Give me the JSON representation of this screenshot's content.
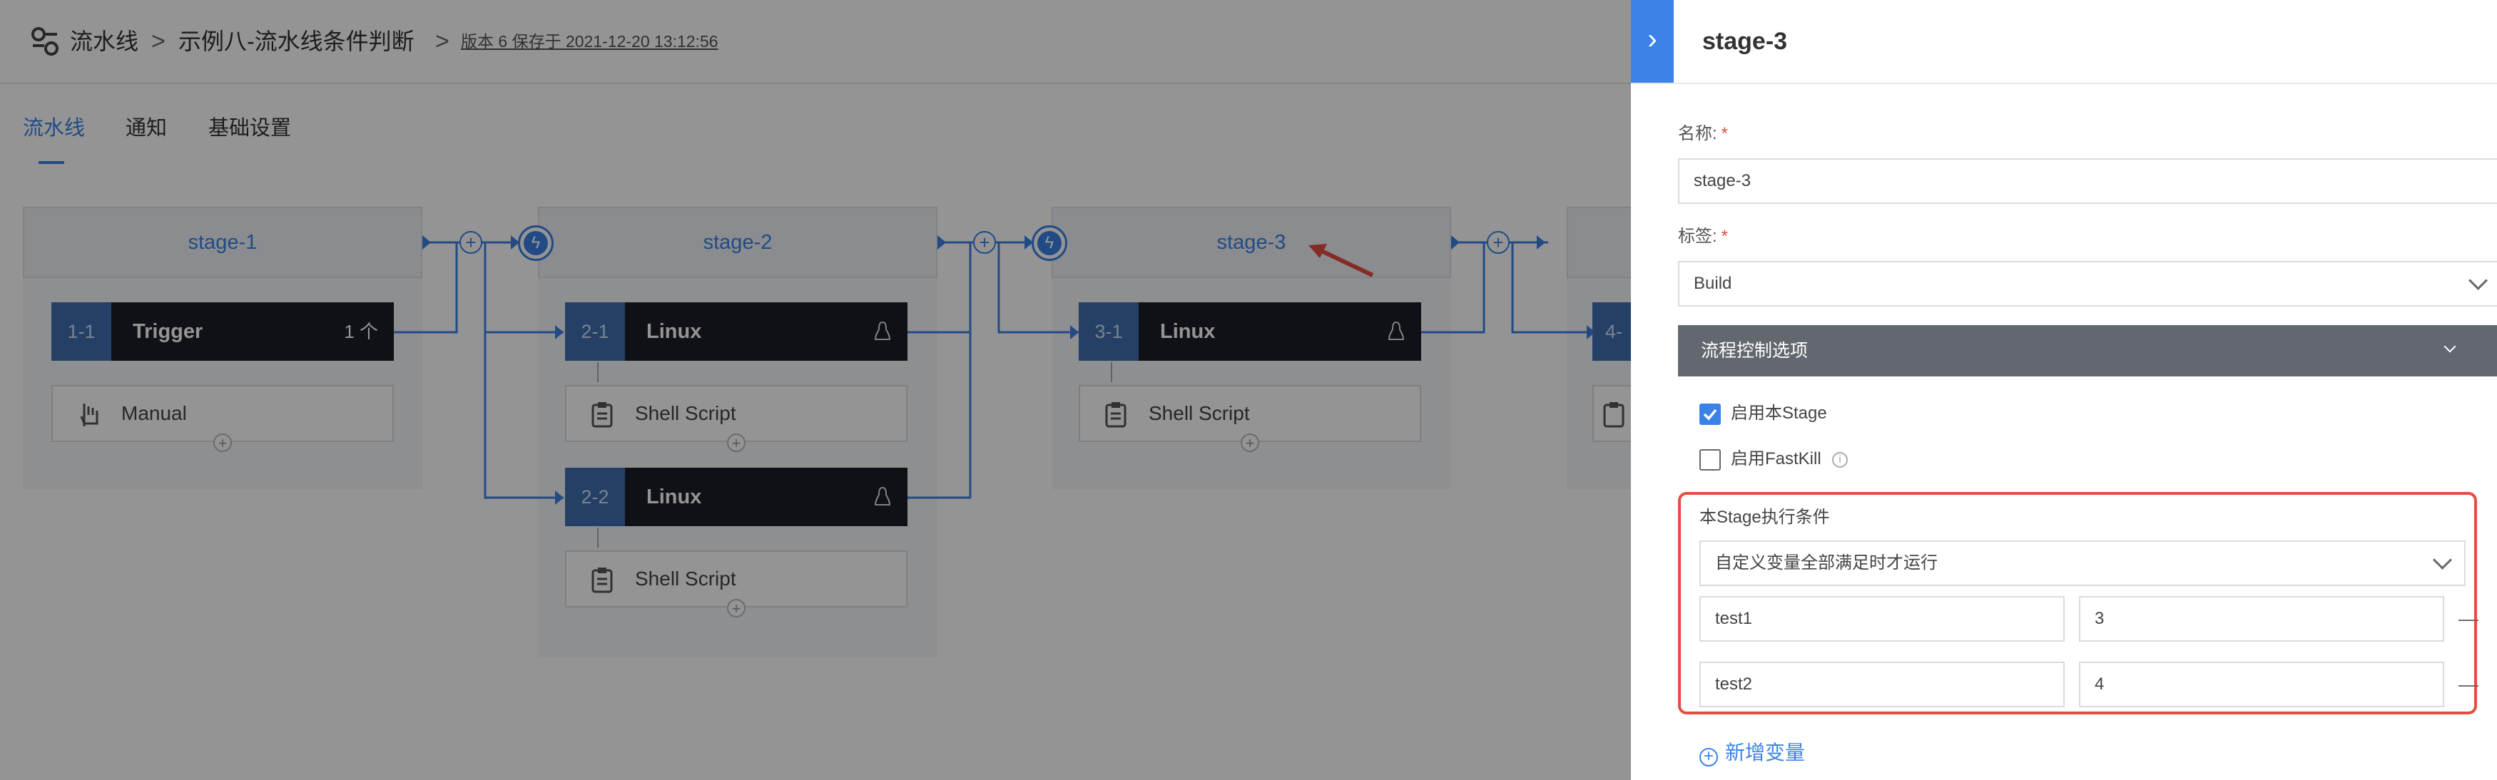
{
  "breadcrumb": {
    "root": "流水线",
    "separator": ">",
    "pipeline_name": "示例八-流水线条件判断",
    "version_info": "版本 6 保存于 2021-12-20 13:12:56"
  },
  "tabs": [
    {
      "label": "流水线",
      "active": true
    },
    {
      "label": "通知",
      "active": false
    },
    {
      "label": "基础设置",
      "active": false
    }
  ],
  "pipeline": {
    "stages": [
      {
        "name": "stage-1",
        "jobs": [
          {
            "num": "1-1",
            "title": "Trigger",
            "badge": "1 个",
            "atom": "Manual",
            "atom_icon": "hand-icon"
          }
        ]
      },
      {
        "name": "stage-2",
        "jobs": [
          {
            "num": "2-1",
            "title": "Linux",
            "os_icon": "linux-icon",
            "atom": "Shell Script",
            "atom_icon": "clipboard-icon"
          },
          {
            "num": "2-2",
            "title": "Linux",
            "os_icon": "linux-icon",
            "atom": "Shell Script",
            "atom_icon": "clipboard-icon"
          }
        ]
      },
      {
        "name": "stage-3",
        "jobs": [
          {
            "num": "3-1",
            "title": "Linux",
            "os_icon": "linux-icon",
            "atom": "Shell Script",
            "atom_icon": "clipboard-icon"
          }
        ]
      },
      {
        "name": "",
        "jobs": [
          {
            "num": "4-",
            "title": "",
            "atom": "",
            "atom_icon": "clipboard-icon"
          }
        ]
      }
    ]
  },
  "panel": {
    "title": "stage-3",
    "name_label": "名称:",
    "name_value": "stage-3",
    "tag_label": "标签:",
    "tag_value": "Build",
    "required_mark": "*",
    "flow_section_title": "流程控制选项",
    "enable_stage_label": "启用本Stage",
    "enable_stage_checked": true,
    "fastkill_label": "启用FastKill",
    "fastkill_checked": false,
    "condition_label": "本Stage执行条件",
    "condition_value": "自定义变量全部满足时才运行",
    "variables": [
      {
        "key": "test1",
        "value": "3"
      },
      {
        "key": "test2",
        "value": "4"
      }
    ],
    "add_variable_label": "新增变量"
  },
  "colors": {
    "accent": "#3c82e6",
    "highlight_border": "#e54d42",
    "job_header": "#1c1e26",
    "section_header": "#63676f"
  }
}
